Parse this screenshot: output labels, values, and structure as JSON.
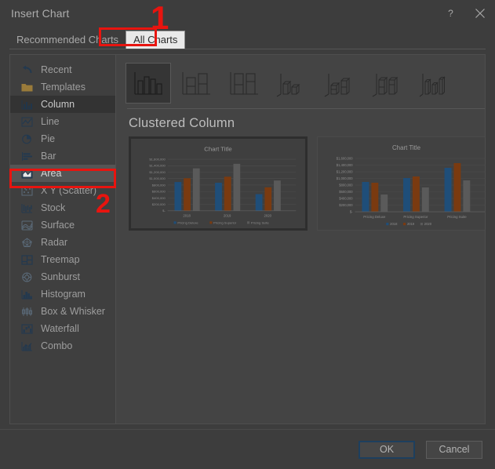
{
  "window": {
    "title": "Insert Chart",
    "help_icon": "question-mark-icon",
    "close_icon": "close-icon"
  },
  "tabs": [
    {
      "label": "Recommended Charts",
      "selected": false
    },
    {
      "label": "All Charts",
      "selected": true
    }
  ],
  "sidebar": {
    "items": [
      {
        "label": "Recent",
        "icon": "recent-undo-icon",
        "state": "normal"
      },
      {
        "label": "Templates",
        "icon": "folder-icon",
        "state": "normal"
      },
      {
        "label": "Column",
        "icon": "column-chart-icon",
        "state": "selected"
      },
      {
        "label": "Line",
        "icon": "line-chart-icon",
        "state": "normal"
      },
      {
        "label": "Pie",
        "icon": "pie-chart-icon",
        "state": "normal"
      },
      {
        "label": "Bar",
        "icon": "bar-chart-icon",
        "state": "normal"
      },
      {
        "label": "Area",
        "icon": "area-chart-icon",
        "state": "hover"
      },
      {
        "label": "X Y (Scatter)",
        "icon": "scatter-chart-icon",
        "state": "normal"
      },
      {
        "label": "Stock",
        "icon": "stock-chart-icon",
        "state": "normal"
      },
      {
        "label": "Surface",
        "icon": "surface-chart-icon",
        "state": "normal"
      },
      {
        "label": "Radar",
        "icon": "radar-chart-icon",
        "state": "normal"
      },
      {
        "label": "Treemap",
        "icon": "treemap-chart-icon",
        "state": "normal"
      },
      {
        "label": "Sunburst",
        "icon": "sunburst-chart-icon",
        "state": "normal"
      },
      {
        "label": "Histogram",
        "icon": "histogram-chart-icon",
        "state": "normal"
      },
      {
        "label": "Box & Whisker",
        "icon": "boxwhisker-chart-icon",
        "state": "normal"
      },
      {
        "label": "Waterfall",
        "icon": "waterfall-chart-icon",
        "state": "normal"
      },
      {
        "label": "Combo",
        "icon": "combo-chart-icon",
        "state": "normal"
      }
    ]
  },
  "subtypes": [
    {
      "name": "clustered-column",
      "selected": true
    },
    {
      "name": "stacked-column",
      "selected": false
    },
    {
      "name": "100-percent-stacked-column",
      "selected": false
    },
    {
      "name": "3d-clustered-column",
      "selected": false
    },
    {
      "name": "3d-stacked-column",
      "selected": false
    },
    {
      "name": "3d-100-percent-stacked-column",
      "selected": false
    },
    {
      "name": "3d-column",
      "selected": false
    }
  ],
  "chart_type_name": "Clustered Column",
  "chart_data": [
    {
      "type": "bar",
      "title": "Chart Title",
      "selected": true,
      "categories": [
        "2018",
        "2019",
        "2020"
      ],
      "series": [
        {
          "name": "Pricing Deluxe",
          "values": [
            900000,
            890000,
            510000
          ],
          "color": "#1F4E79"
        },
        {
          "name": "Pricing Superior",
          "values": [
            1000000,
            1070000,
            740000
          ],
          "color": "#7A3A10"
        },
        {
          "name": "Pricing Suite",
          "values": [
            1310000,
            1460000,
            930000
          ],
          "color": "#5A5A5A"
        }
      ],
      "ylabel": "",
      "xlabel": "",
      "ylim": [
        0,
        1600000
      ],
      "yticks": [
        "$1,600,000",
        "$1,400,000",
        "$1,200,000",
        "$1,000,000",
        "$800,000",
        "$600,000",
        "$400,000",
        "$200,000",
        "$-"
      ],
      "grid": true,
      "legend_position": "bottom"
    },
    {
      "type": "bar",
      "title": "Chart Title",
      "selected": false,
      "categories": [
        "Pricing Deluxe",
        "Pricing Superior",
        "Pricing Suite"
      ],
      "series": [
        {
          "name": "2018",
          "values": [
            900000,
            1000000,
            1310000
          ],
          "color": "#1F4E79"
        },
        {
          "name": "2019",
          "values": [
            890000,
            1070000,
            1460000
          ],
          "color": "#7A3A10"
        },
        {
          "name": "2020",
          "values": [
            510000,
            740000,
            930000
          ],
          "color": "#5A5A5A"
        }
      ],
      "ylabel": "",
      "xlabel": "",
      "ylim": [
        0,
        1600000
      ],
      "yticks": [
        "$1,600,000",
        "$1,400,000",
        "$1,200,000",
        "$1,000,000",
        "$800,000",
        "$600,000",
        "$400,000",
        "$200,000",
        "$-"
      ],
      "grid": true,
      "legend_position": "bottom"
    }
  ],
  "footer": {
    "ok_label": "OK",
    "cancel_label": "Cancel"
  },
  "annotations": [
    {
      "label": "1",
      "target": "All Charts tab",
      "color": "#E8140F"
    },
    {
      "label": "2",
      "target": "Area sidebar item",
      "color": "#E8140F"
    }
  ]
}
